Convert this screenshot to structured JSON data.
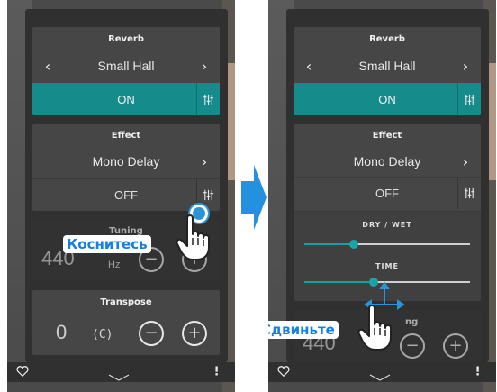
{
  "colors": {
    "accent": "#168b8b",
    "label_blue": "#1480e6"
  },
  "left": {
    "reverb": {
      "title": "Reverb",
      "type": "Small Hall",
      "state": "ON"
    },
    "effect": {
      "title": "Effect",
      "type": "Mono Delay",
      "state": "OFF"
    },
    "tuning": {
      "title": "Tuning",
      "value": "440",
      "unit": "Hz"
    },
    "transpose": {
      "title": "Transpose",
      "value": "0",
      "key": "(C)"
    },
    "callout": "Коснитесь"
  },
  "right": {
    "reverb": {
      "title": "Reverb",
      "type": "Small Hall",
      "state": "ON"
    },
    "effect": {
      "title": "Effect",
      "type": "Mono Delay",
      "state": "OFF"
    },
    "slider_drywet": {
      "label": "DRY / WET",
      "level": 0.3
    },
    "slider_time": {
      "label": "TIME",
      "level": 0.42
    },
    "tuning_partial": {
      "value": "440",
      "title_tail": "ng"
    },
    "callout": "Сдвиньте"
  },
  "icons": {
    "prev": "chevron-left-icon",
    "next": "chevron-right-icon",
    "settings": "sliders-icon",
    "favorite": "heart-outline-icon",
    "collapse": "chevron-down-icon",
    "more": "vertical-dots-icon",
    "transition": "blue-arrow-right-icon"
  },
  "bottom": {
    "more_glyph": "⋮"
  }
}
